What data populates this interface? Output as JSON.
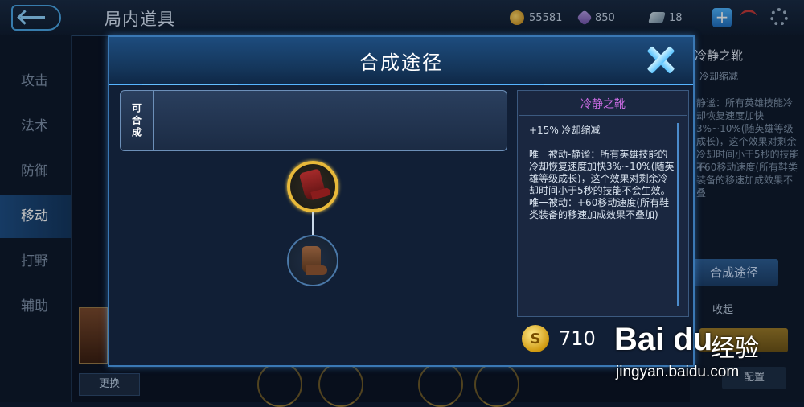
{
  "topbar": {
    "title": "局内道具",
    "gold": "55581",
    "gems": "850",
    "tickets": "18"
  },
  "sidebar": {
    "items": [
      {
        "label": "攻击"
      },
      {
        "label": "法术"
      },
      {
        "label": "防御"
      },
      {
        "label": "移动"
      },
      {
        "label": "打野"
      },
      {
        "label": "辅助"
      }
    ],
    "active": "移动"
  },
  "background_panel": {
    "item_name": "冷静之靴",
    "sub": "冷却缩减",
    "text1": "静谧：所有英雄技能冷却恢复速度加快3%~10%(随英雄等级成长)，这个效果对剩余冷却时间小于5秒的技能不",
    "text2": "+60移动速度(所有鞋类装备的移速加成效果不叠",
    "path_button": "合成途径",
    "collapse": "收起",
    "config_button": "配置",
    "switch_button": "更换"
  },
  "modal": {
    "title": "合成途径",
    "combine_label": "可合成",
    "item": {
      "name": "冷静之靴",
      "stat": "+15% 冷却缩减",
      "desc": "唯一被动-静谧：所有英雄技能的冷却恢复速度加快3%~10%(随英雄等级成长)，这个效果对剩余冷却时间小于5秒的技能不会生效。\n唯一被动：+60移动速度(所有鞋类装备的移速加成效果不叠加)",
      "price": "710",
      "coin_symbol": "S"
    }
  },
  "watermark": {
    "logo": "Bai du",
    "cn": "经验",
    "url": "jingyan.baidu.com"
  }
}
